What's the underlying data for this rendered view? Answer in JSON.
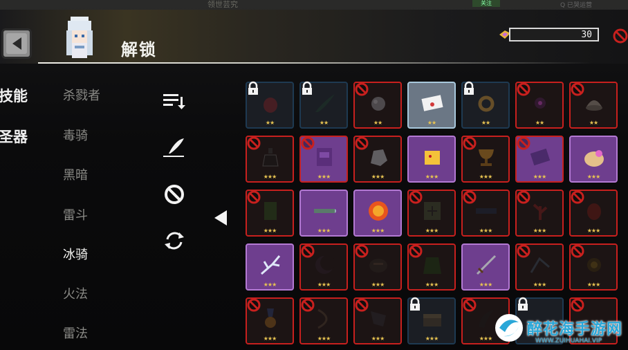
{
  "ghost": {
    "title": "领世芸究",
    "button": "关注",
    "search": "Q 已哭运营"
  },
  "header": {
    "title": "解锁",
    "currency_value": "30"
  },
  "tabs": [
    {
      "label": "技能"
    },
    {
      "label": "圣器"
    }
  ],
  "heroes": [
    {
      "label": "杀戮者"
    },
    {
      "label": "毒骑"
    },
    {
      "label": "黑暗"
    },
    {
      "label": "雷斗"
    },
    {
      "label": "冰骑"
    },
    {
      "label": "火法"
    },
    {
      "label": "雷法"
    }
  ],
  "selected_hero": "冰骑",
  "tools": [
    {
      "icon": "sort-icon"
    },
    {
      "icon": "feather-icon"
    },
    {
      "icon": "ban-icon"
    },
    {
      "icon": "refresh-icon"
    }
  ],
  "colors": {
    "banned_border": "#c8201e",
    "rare_bg": "#6e3e8e",
    "locked_border": "#1e3a52",
    "star": "#e8c452",
    "accent_watermark": "#2aa7d8"
  },
  "grid": [
    [
      {
        "state": "locked",
        "icon": "red-pouch",
        "stars": "★★"
      },
      {
        "state": "locked",
        "icon": "dark-feather",
        "stars": "★★"
      },
      {
        "state": "banned",
        "icon": "grey-rock",
        "stars": "★★"
      },
      {
        "state": "normal",
        "icon": "letter",
        "stars": "★★"
      },
      {
        "state": "locked",
        "icon": "ring",
        "stars": "★★"
      },
      {
        "state": "banned",
        "icon": "dark-orb",
        "stars": "★★"
      },
      {
        "state": "banned",
        "icon": "shell",
        "stars": "★★"
      }
    ],
    [
      {
        "state": "banned",
        "icon": "potion",
        "stars": "★★★"
      },
      {
        "state": "rare-banned",
        "icon": "purple-pack",
        "stars": "★★★"
      },
      {
        "state": "banned",
        "icon": "stone",
        "stars": "★★★"
      },
      {
        "state": "rare",
        "icon": "cheese",
        "stars": "★★★"
      },
      {
        "state": "banned",
        "icon": "chalice",
        "stars": "★★★"
      },
      {
        "state": "rare-banned",
        "icon": "tome",
        "stars": "★★★"
      },
      {
        "state": "rare",
        "icon": "bag",
        "stars": "★★★"
      }
    ],
    [
      {
        "state": "banned",
        "icon": "green-leaf",
        "stars": "★★★"
      },
      {
        "state": "rare",
        "icon": "rocket",
        "stars": "★★★"
      },
      {
        "state": "rare",
        "icon": "fire-orb",
        "stars": "★★★"
      },
      {
        "state": "banned",
        "icon": "map",
        "stars": "★★★"
      },
      {
        "state": "banned",
        "icon": "goggles",
        "stars": "★★★"
      },
      {
        "state": "banned",
        "icon": "red-plant",
        "stars": "★★★"
      },
      {
        "state": "banned",
        "icon": "red-egg",
        "stars": "★★★"
      }
    ],
    [
      {
        "state": "rare",
        "icon": "ice-branch",
        "stars": "★★★"
      },
      {
        "state": "banned",
        "icon": "moon",
        "stars": "★★★"
      },
      {
        "state": "banned",
        "icon": "dark-sack",
        "stars": "★★★"
      },
      {
        "state": "banned",
        "icon": "cloak",
        "stars": "★★★"
      },
      {
        "state": "rare",
        "icon": "sword",
        "stars": "★★★"
      },
      {
        "state": "banned",
        "icon": "ice-shard",
        "stars": "★★★"
      },
      {
        "state": "banned",
        "icon": "gold-coin",
        "stars": "★★★"
      }
    ],
    [
      {
        "state": "banned",
        "icon": "medal",
        "stars": "★★★"
      },
      {
        "state": "banned",
        "icon": "bow",
        "stars": "★★★"
      },
      {
        "state": "banned",
        "icon": "claw",
        "stars": "★★★"
      },
      {
        "state": "locked",
        "icon": "chest",
        "stars": "★★★"
      },
      {
        "state": "banned",
        "icon": "horn",
        "stars": "★★★"
      },
      {
        "state": "locked",
        "icon": "unknown",
        "stars": ""
      },
      {
        "state": "banned",
        "icon": "unknown",
        "stars": ""
      }
    ]
  ],
  "watermark": {
    "text": "醉花海手游网",
    "url": "WWW.ZUIHUAHAI.VIP"
  }
}
